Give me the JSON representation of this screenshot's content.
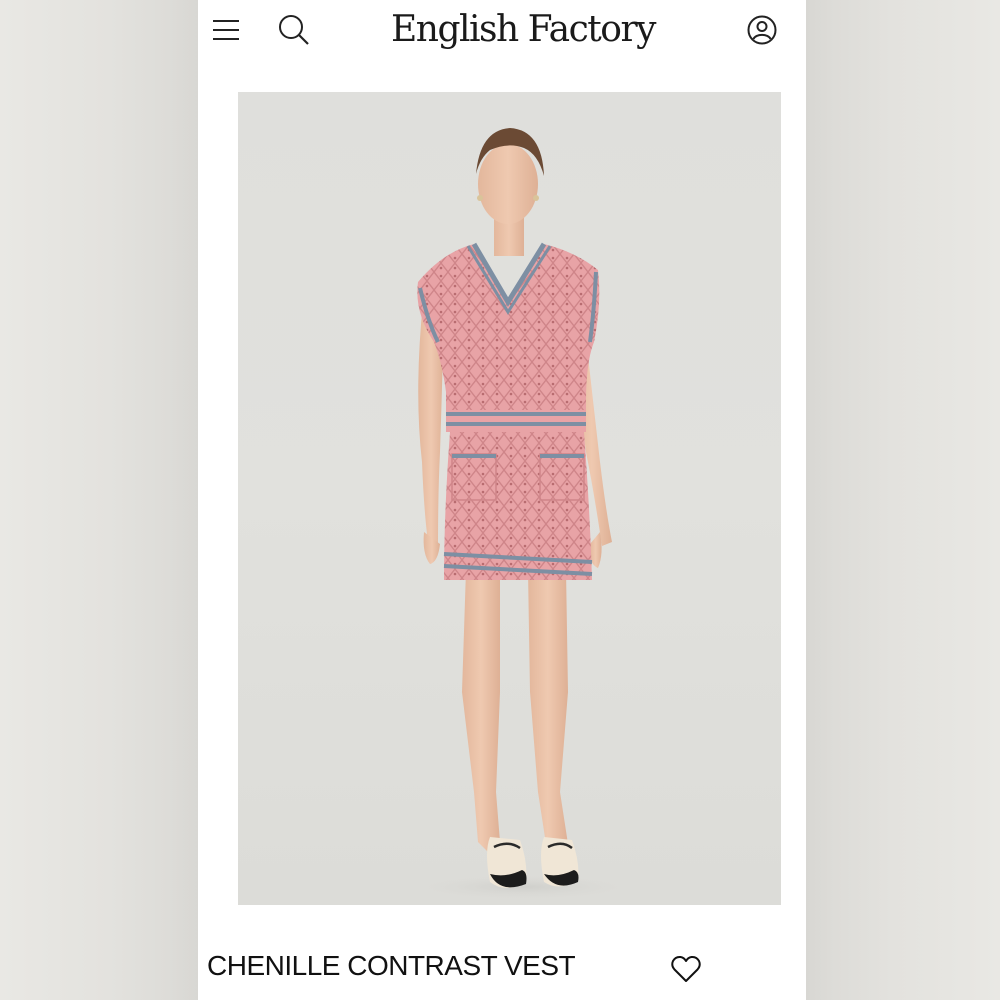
{
  "header": {
    "brand": "English Factory",
    "menu_icon": "hamburger-menu-icon",
    "search_icon": "search-icon",
    "account_icon": "user-account-icon"
  },
  "product": {
    "title": "CHENILLE CONTRAST VEST",
    "wishlist_icon": "heart-outline-icon",
    "image": {
      "subject": "product-photo",
      "garment_color": "#e8a3a6",
      "trim_color": "#7d8fa3",
      "background_color": "#dfdfdc"
    }
  }
}
